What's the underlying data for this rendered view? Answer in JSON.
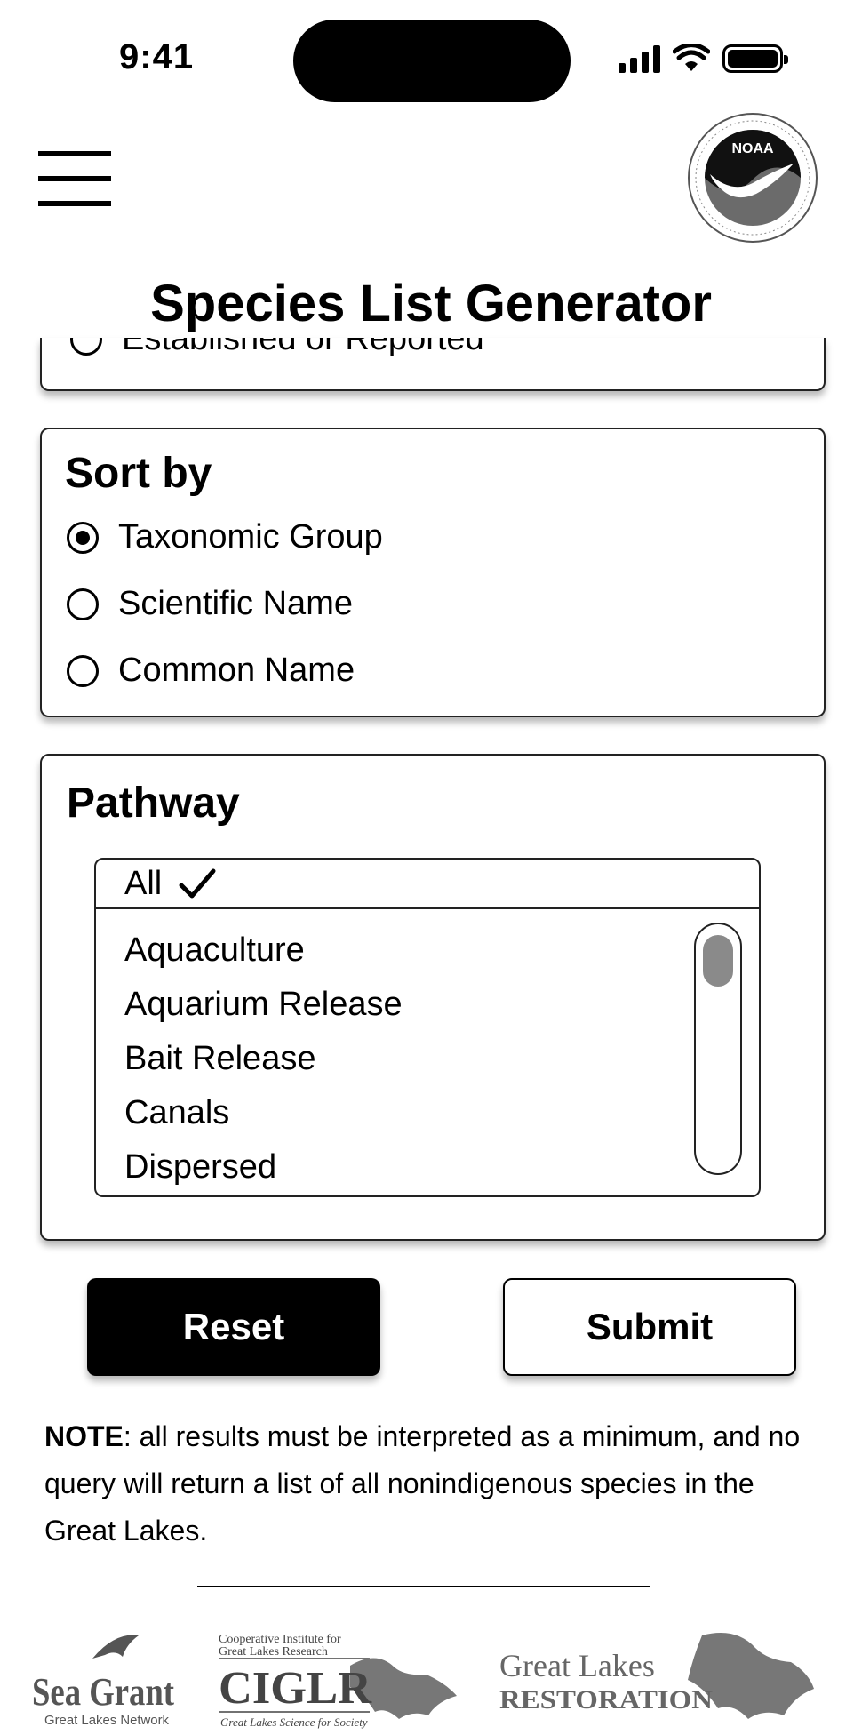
{
  "status_bar": {
    "time": "9:41"
  },
  "header": {
    "title": "Species List Generator"
  },
  "status_filter": {
    "partial_option": "Established or Reported"
  },
  "sort_by": {
    "heading": "Sort by",
    "options": [
      "Taxonomic Group",
      "Scientific Name",
      "Common Name"
    ],
    "selected": "Taxonomic Group"
  },
  "pathway": {
    "heading": "Pathway",
    "selected_label": "All",
    "items": [
      "Aquaculture",
      "Aquarium Release",
      "Bait Release",
      "Canals",
      "Dispersed"
    ]
  },
  "buttons": {
    "reset": "Reset",
    "submit": "Submit"
  },
  "note": {
    "label": "NOTE",
    "text": ": all results must be interpreted as a minimum, and no query will return a list of all nonindigenous species in the Great Lakes."
  },
  "logos": {
    "noaa": "NOAA",
    "seagrant": "Sea Grant",
    "seagrant_sub": "Great Lakes Network",
    "ciglr_top1": "Cooperative Institute for",
    "ciglr_top2": "Great Lakes Research",
    "ciglr": "CIGLR",
    "ciglr_sub": "Great Lakes Science for Society",
    "glr_line1": "Great Lakes",
    "glr_line2": "RESTORATION"
  }
}
